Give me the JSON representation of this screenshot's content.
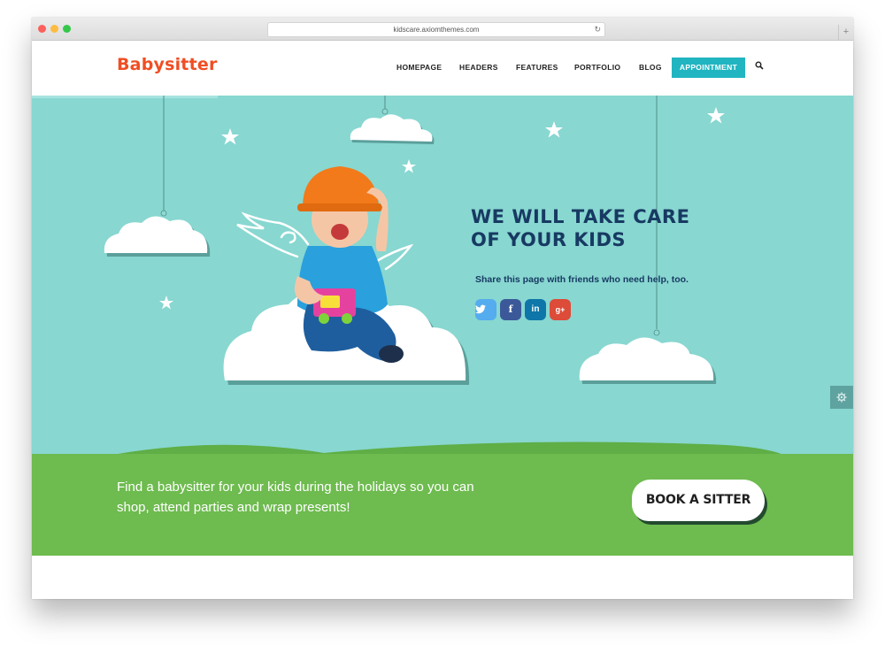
{
  "browser": {
    "url": "kidscare.axiomthemes.com"
  },
  "header": {
    "logo": "Babysitter",
    "nav": [
      {
        "label": "HOMEPAGE"
      },
      {
        "label": "HEADERS"
      },
      {
        "label": "FEATURES"
      },
      {
        "label": "PORTFOLIO"
      },
      {
        "label": "BLOG"
      }
    ],
    "cta_label": "APPOINTMENT",
    "accent_color": "#21b5c1"
  },
  "hero": {
    "headline_line1": "WE WILL TAKE CARE",
    "headline_line2": "OF YOUR KIDS",
    "share_text": "Share this page with friends who need help, too.",
    "social": [
      {
        "name": "twitter-icon",
        "glyph": "🐦",
        "color": "#55acee"
      },
      {
        "name": "facebook-icon",
        "glyph": "f",
        "color": "#3b5998"
      },
      {
        "name": "linkedin-icon",
        "glyph": "in",
        "color": "#0e76a8"
      },
      {
        "name": "google-plus-icon",
        "glyph": "g+",
        "color": "#dd4b39"
      }
    ],
    "background_color": "#88d7d1"
  },
  "promo": {
    "text": "Find a babysitter for your kids during the holidays so you can shop, attend parties and wrap presents!",
    "button_label": "BOOK A SITTER",
    "background_color": "#6ebb4f"
  }
}
